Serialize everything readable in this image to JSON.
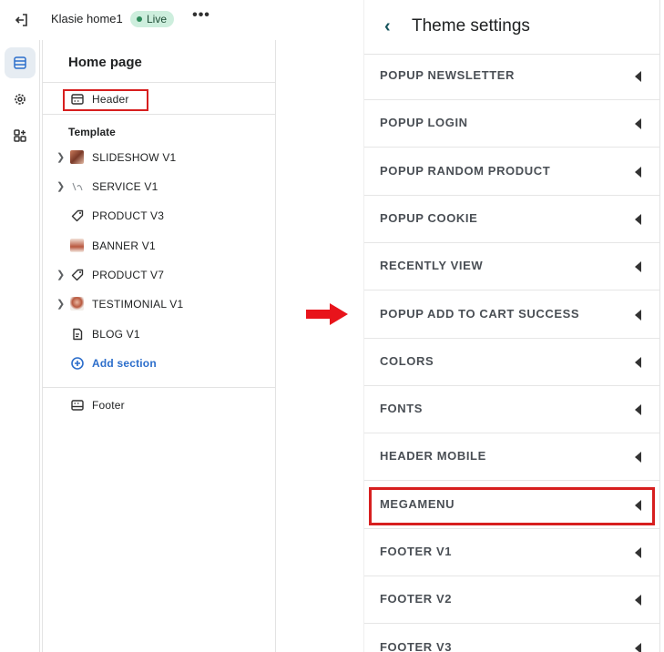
{
  "topbar": {
    "store_name": "Klasie home1",
    "status": "Live",
    "more": "•••"
  },
  "rail": {
    "items": [
      {
        "name": "sections-icon",
        "active": true
      },
      {
        "name": "gear-icon",
        "active": false
      },
      {
        "name": "apps-icon",
        "active": false
      }
    ]
  },
  "editor": {
    "page_title": "Home page",
    "header_label": "Header",
    "template_heading": "Template",
    "sections": [
      {
        "label": "SLIDESHOW V1",
        "expandable": true,
        "icon": "thumbnail"
      },
      {
        "label": "SERVICE V1",
        "expandable": true,
        "icon": "thumbnail"
      },
      {
        "label": "PRODUCT V3",
        "expandable": false,
        "icon": "tag-icon"
      },
      {
        "label": "BANNER V1",
        "expandable": false,
        "icon": "thumbnail"
      },
      {
        "label": "PRODUCT V7",
        "expandable": true,
        "icon": "tag-icon"
      },
      {
        "label": "TESTIMONIAL V1",
        "expandable": true,
        "icon": "thumbnail"
      },
      {
        "label": "BLOG V1",
        "expandable": false,
        "icon": "blog-icon"
      }
    ],
    "add_section": "Add section",
    "footer_label": "Footer"
  },
  "theme_settings": {
    "title": "Theme settings",
    "items": [
      "POPUP NEWSLETTER",
      "POPUP LOGIN",
      "POPUP RANDOM PRODUCT",
      "POPUP COOKIE",
      "RECENTLY VIEW",
      "POPUP ADD TO CART SUCCESS",
      "COLORS",
      "FONTS",
      "HEADER MOBILE",
      "MEGAMENU",
      "FOOTER V1",
      "FOOTER V2",
      "FOOTER V3"
    ],
    "highlighted": "MEGAMENU"
  },
  "colors": {
    "highlight": "#d71f1f",
    "live_badge": "#cdeedd",
    "link_blue": "#2c6ecb",
    "arrow_red": "#e8141b"
  }
}
